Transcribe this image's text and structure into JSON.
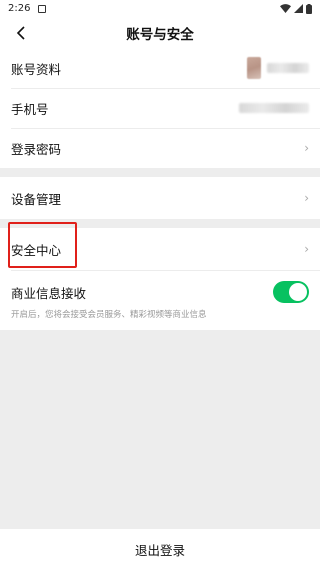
{
  "status_bar": {
    "time": "2:26"
  },
  "nav": {
    "title": "账号与安全"
  },
  "group1": {
    "account_info": "账号资料",
    "phone": "手机号",
    "login_password": "登录密码"
  },
  "group2": {
    "device_manage": "设备管理"
  },
  "group3": {
    "security_center": "安全中心",
    "commercial_info": "商业信息接收",
    "commercial_info_desc": "开启后，您将会接受会员服务、精彩视频等商业信息"
  },
  "toggle_state": "on",
  "footer": {
    "logout": "退出登录"
  },
  "colors": {
    "accent": "#07c160",
    "highlight": "#e0201a"
  }
}
